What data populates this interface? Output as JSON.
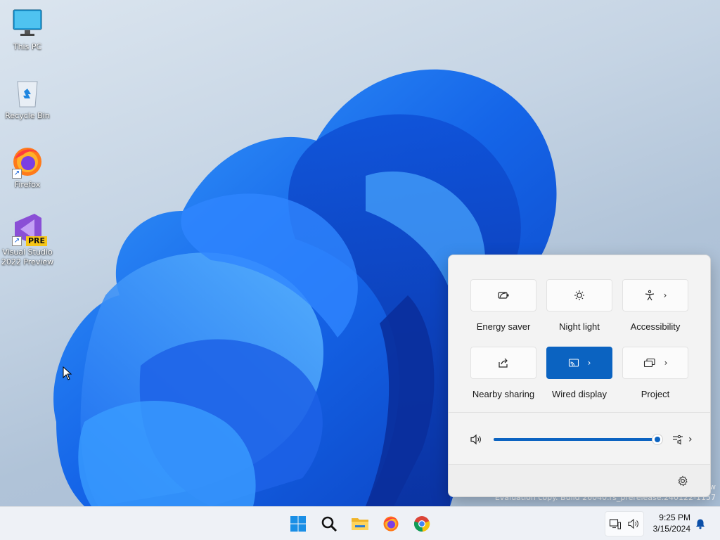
{
  "desktop": {
    "icons": [
      {
        "label": "This PC",
        "icon": "monitor-icon"
      },
      {
        "label": "Recycle Bin",
        "icon": "recycle-bin-icon"
      },
      {
        "label": "Firefox",
        "icon": "firefox-icon"
      },
      {
        "label": "Visual Studio\n2022 Preview",
        "icon": "visual-studio-preview-icon",
        "badge": "PRE"
      }
    ],
    "watermark": {
      "line1": "w",
      "line2": "Evaluation copy. Build 26040.rs_prerelease.240122-1157"
    }
  },
  "quick_settings": {
    "tiles": [
      {
        "label": "Energy saver",
        "icon": "energy-saver-icon",
        "active": false,
        "has_chevron": false
      },
      {
        "label": "Night light",
        "icon": "night-light-icon",
        "active": false,
        "has_chevron": false
      },
      {
        "label": "Accessibility",
        "icon": "accessibility-icon",
        "active": false,
        "has_chevron": true
      },
      {
        "label": "Nearby sharing",
        "icon": "nearby-sharing-icon",
        "active": false,
        "has_chevron": false
      },
      {
        "label": "Wired display",
        "icon": "cast-icon",
        "active": true,
        "has_chevron": true
      },
      {
        "label": "Project",
        "icon": "project-icon",
        "active": false,
        "has_chevron": true
      }
    ],
    "volume": {
      "level": 1.0,
      "icon": "speaker-icon",
      "mixer_icon": "audio-mixer-icon"
    },
    "footer": {
      "settings_icon": "gear-icon"
    }
  },
  "taskbar": {
    "apps": [
      {
        "name": "Start",
        "icon": "windows-start-icon"
      },
      {
        "name": "Search",
        "icon": "search-icon"
      },
      {
        "name": "File Explorer",
        "icon": "folder-icon"
      },
      {
        "name": "Firefox",
        "icon": "firefox-icon"
      },
      {
        "name": "Chrome",
        "icon": "chrome-icon"
      }
    ],
    "tray": {
      "network_icon": "network-icon",
      "volume_icon": "speaker-icon"
    },
    "clock": {
      "time": "9:25 PM",
      "date": "3/15/2024"
    },
    "notification_icon": "bell-icon"
  },
  "colors": {
    "accent": "#0b63c1",
    "taskbar_bg": "#eef1f6",
    "panel_bg": "#f3f3f3"
  }
}
